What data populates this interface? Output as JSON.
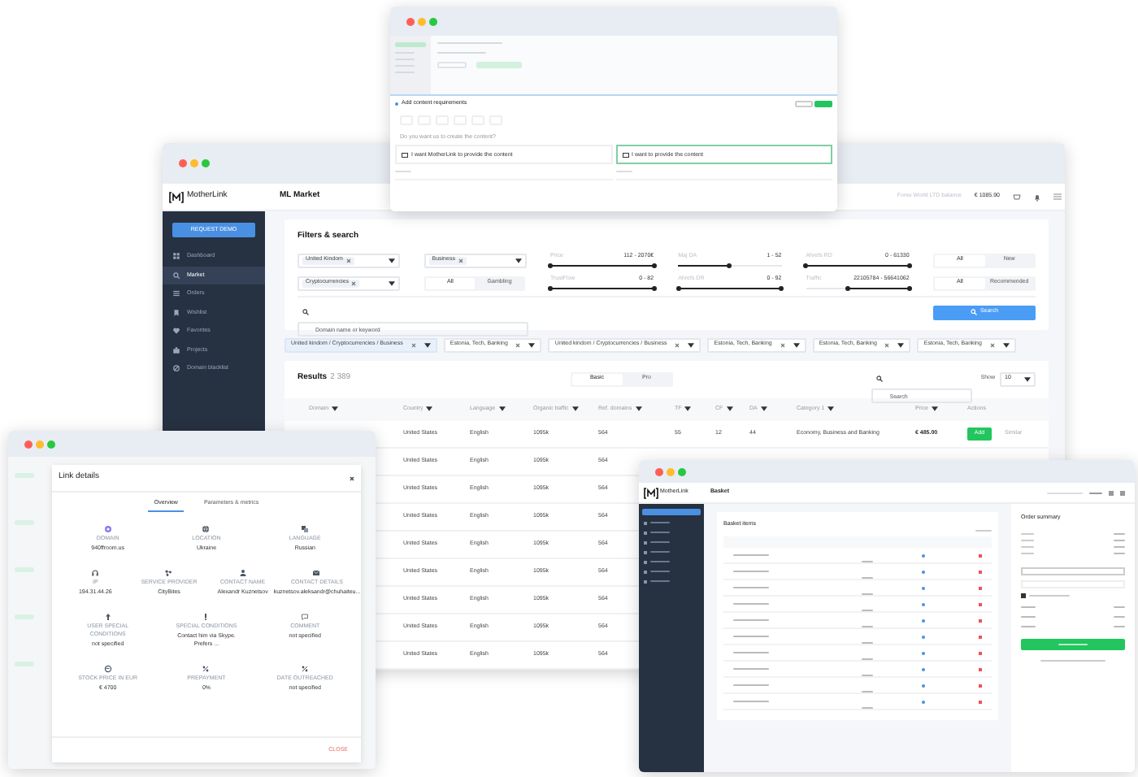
{
  "top_window": {
    "title": "Add content requirements",
    "question": "Do you want us to create the content?",
    "options": [
      {
        "title": "I want MotherLink to provide the content",
        "selected": false
      },
      {
        "title": "I want to provide the content",
        "selected": true
      }
    ]
  },
  "market_window": {
    "brand": "MotherLink",
    "page_title": "ML Market",
    "balance_label": "Forex World LTD balance",
    "balance": "€ 1085.90",
    "sidebar": {
      "button": "REQUEST DEMO",
      "items": [
        {
          "label": "Dashboard",
          "selected": false
        },
        {
          "label": "Market",
          "selected": true
        },
        {
          "label": "Orders",
          "selected": false
        },
        {
          "label": "Wishlist",
          "selected": false
        },
        {
          "label": "Favorites",
          "selected": false
        },
        {
          "label": "Projects",
          "selected": false
        },
        {
          "label": "Domain blacklist",
          "selected": false
        }
      ]
    },
    "filters": {
      "title": "Filters & search",
      "rows": [
        [
          {
            "kind": "select",
            "chips": [
              "United Kindom"
            ]
          },
          {
            "kind": "select",
            "chips": [
              "Business"
            ]
          },
          {
            "kind": "slider",
            "label": "Price",
            "reading": "112 - 2070€",
            "thumbs": [
              {
                "level": 0
              },
              {
                "level": 1
              }
            ]
          },
          {
            "kind": "slider",
            "label": "Maj DA",
            "reading": "1 - 52",
            "thumbs": [
              {
                "level": 0.5
              }
            ]
          },
          {
            "kind": "slider",
            "label": "Ahrefs RD",
            "reading": "0 - 61330",
            "thumbs": [
              {
                "level": 0
              },
              {
                "level": 1
              }
            ]
          },
          {
            "kind": "toggle",
            "options": [
              {
                "label": "All",
                "selected": true
              },
              {
                "label": "New",
                "selected": false
              }
            ]
          }
        ],
        [
          {
            "kind": "select",
            "chips": [
              "Cryptocurrencies"
            ]
          },
          {
            "kind": "toggle",
            "options": [
              {
                "label": "All",
                "selected": true
              },
              {
                "label": "Gambling",
                "selected": false
              }
            ]
          },
          {
            "kind": "slider",
            "label": "TrustFlow",
            "reading": "0 - 82",
            "thumbs": [
              {
                "level": 0
              },
              {
                "level": 1
              }
            ]
          },
          {
            "kind": "slider",
            "label": "Ahrefs DR",
            "reading": "0 - 92",
            "thumbs": [
              {
                "level": 0
              },
              {
                "level": 1
              }
            ]
          },
          {
            "kind": "slider",
            "label": "Traffic",
            "reading": "22105784 - 56641062",
            "thumbs": [
              {
                "level": 0.4
              },
              {
                "level": 1
              }
            ]
          },
          {
            "kind": "toggle",
            "options": [
              {
                "label": "All",
                "selected": true
              },
              {
                "label": "Recommended",
                "selected": false
              }
            ]
          }
        ]
      ],
      "search_placeholder": "Domain name or keyword",
      "search_button": "Search"
    },
    "tags": [
      {
        "label": "United kindom / Cryptocurrencies / Business",
        "selected": true
      },
      {
        "label": "Estonia, Tech, Banking",
        "selected": false
      },
      {
        "label": "United kindom / Cryptocurrencies / Business",
        "selected": false
      },
      {
        "label": "Estonia, Tech, Banking",
        "selected": false
      },
      {
        "label": "Estonia, Tech, Banking",
        "selected": false
      },
      {
        "label": "Estonia, Tech, Banking",
        "selected": false
      }
    ],
    "results": {
      "title": "Results",
      "count": "2 389",
      "views": [
        {
          "label": "Basic",
          "selected": true
        },
        {
          "label": "Pro",
          "selected": false
        }
      ],
      "search_placeholder": "Search",
      "show_label": "Show",
      "show_value": "10",
      "columns": [
        "Domain",
        "Country",
        "Language",
        "Organic traffic",
        "Ref. domains",
        "TF",
        "CF",
        "DA",
        "Category 1",
        "Price",
        "Actions"
      ],
      "rows": [
        {
          "country": "United States",
          "language": "English",
          "organic_traffic": "1095k",
          "ref_domains": "564",
          "tf": "55",
          "cf": "12",
          "da": "44",
          "category": "Economy, Business and Banking",
          "price": "€ 485.00",
          "add": "Add",
          "similar": "Similar"
        },
        {
          "country": "United States",
          "language": "English",
          "organic_traffic": "1095k",
          "ref_domains": "564"
        },
        {
          "country": "United States",
          "language": "English",
          "organic_traffic": "1095k",
          "ref_domains": "564"
        },
        {
          "country": "United States",
          "language": "English",
          "organic_traffic": "1095k",
          "ref_domains": "564"
        },
        {
          "country": "United States",
          "language": "English",
          "organic_traffic": "1095k",
          "ref_domains": "564"
        },
        {
          "country": "United States",
          "language": "English",
          "organic_traffic": "1095k",
          "ref_domains": "564"
        },
        {
          "country": "United States",
          "language": "English",
          "organic_traffic": "1095k",
          "ref_domains": "564"
        },
        {
          "country": "United States",
          "language": "English",
          "organic_traffic": "1095k",
          "ref_domains": "564"
        },
        {
          "country": "United States",
          "language": "English",
          "organic_traffic": "1095k",
          "ref_domains": "564"
        }
      ]
    }
  },
  "link_details": {
    "title": "Link details",
    "tabs": [
      {
        "label": "Overview",
        "selected": true
      },
      {
        "label": "Parameters & metrics",
        "selected": false
      }
    ],
    "rows": [
      [
        {
          "label": "DOMAIN",
          "value": "940ffroom.us"
        },
        {
          "label": "LOCATION",
          "value": "Ukraine"
        },
        {
          "label": "LANGUAGE",
          "value": "Russian"
        }
      ],
      [
        {
          "label": "IP",
          "value": "194.31.44.26"
        },
        {
          "label": "SERVICE PROVIDER",
          "value": "CityBites"
        },
        {
          "label": "CONTACT NAME",
          "value": "Alexandr Kuznetsov"
        },
        {
          "label": "CONTACT DETAILS",
          "value": "kuznetsov.aleksandr@chuhaiteu..."
        }
      ],
      [
        {
          "label": "USER SPECIAL CONDITIONS",
          "value": "not specified"
        },
        {
          "label": "SPECIAL CONDITIONS",
          "value": "Contact him via Skype. Prefers ..."
        },
        {
          "label": "COMMENT",
          "value": "not specified"
        }
      ],
      [
        {
          "label": "STOCK PRICE IN EUR",
          "value": "€ 4700"
        },
        {
          "label": "PREPAYMENT",
          "value": "0%"
        },
        {
          "label": "DATE OUTREACHED",
          "value": "not specified"
        }
      ]
    ],
    "close_button": "CLOSE"
  },
  "basket_window": {
    "brand": "MotherLink",
    "page_title": "Basket",
    "panel_title": "Basket items",
    "summary_title": "Order summary",
    "terms_checkbox": {
      "checked": true
    }
  }
}
